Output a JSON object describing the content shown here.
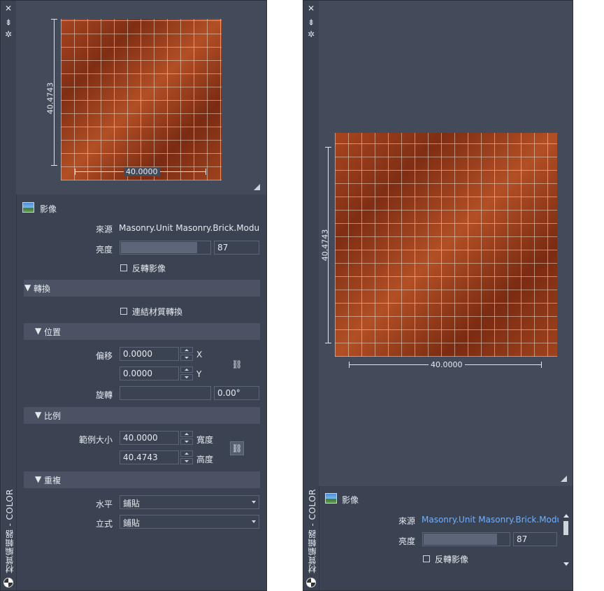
{
  "palette": {
    "title": "材質編輯器 - COLOR"
  },
  "preview": {
    "width_label": "40.0000",
    "height_label": "40.4743"
  },
  "image_section": {
    "label": "影像",
    "source_label": "來源",
    "source_value": "Masonry.Unit Masonry.Brick.Modular",
    "source_value_right": "Masonry.Unit Masonry.Brick.Modul",
    "brightness_label": "亮度",
    "brightness_value": "87",
    "brightness_percent": 87,
    "invert_label": "反轉影像"
  },
  "transforms": {
    "label": "轉換",
    "link_label": "連結材質轉換",
    "position": {
      "label": "位置",
      "offset_label": "偏移",
      "offset_x": "0.0000",
      "offset_y": "0.0000",
      "x_label": "X",
      "y_label": "Y",
      "rotation_label": "旋轉",
      "rotation_value": "0.00°"
    },
    "scale": {
      "label": "比例",
      "sample_size_label": "範例大小",
      "width_value": "40.0000",
      "height_value": "40.4743",
      "width_label": "寬度",
      "height_label": "高度"
    },
    "repeat": {
      "label": "重複",
      "horizontal_label": "水平",
      "horizontal_value": "鋪貼",
      "vertical_label": "立式",
      "vertical_value": "鋪貼"
    }
  },
  "icons": {
    "close": "close-icon",
    "pin": "pin-icon",
    "settings": "gear-icon",
    "link": "link-icon",
    "palette": "material-palette-icon"
  },
  "colors": {
    "panel_bg": "#3b4353",
    "band_bg": "#4a5263",
    "link_text": "#6fb1ff",
    "brick": "#8e3517"
  }
}
